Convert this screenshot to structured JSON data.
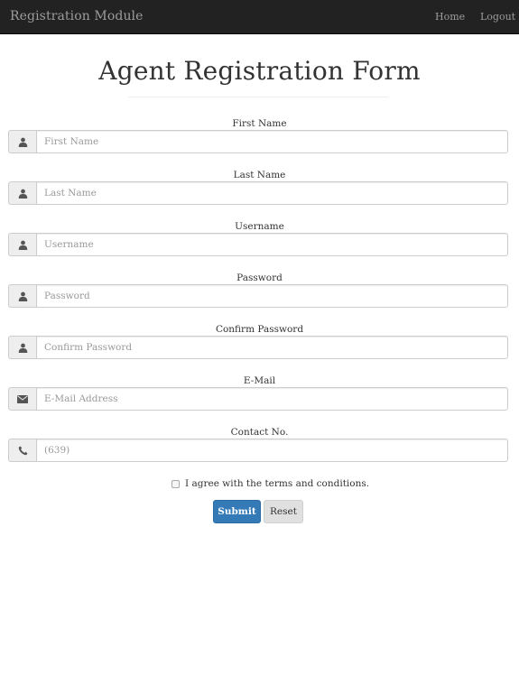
{
  "navbar": {
    "brand": "Registration Module",
    "links": [
      {
        "label": "Home"
      },
      {
        "label": "Logout"
      }
    ]
  },
  "page": {
    "title": "Agent Registration Form"
  },
  "form": {
    "fields": [
      {
        "label": "First Name",
        "placeholder": "First Name",
        "value": "",
        "icon": "user-icon"
      },
      {
        "label": "Last Name",
        "placeholder": "Last Name",
        "value": "",
        "icon": "user-icon"
      },
      {
        "label": "Username",
        "placeholder": "Username",
        "value": "",
        "icon": "user-icon"
      },
      {
        "label": "Password",
        "placeholder": "Password",
        "value": "",
        "icon": "user-icon"
      },
      {
        "label": "Confirm Password",
        "placeholder": "Confirm Password",
        "value": "",
        "icon": "user-icon"
      },
      {
        "label": "E-Mail",
        "placeholder": "E-Mail Address",
        "value": "",
        "icon": "envelope-icon"
      },
      {
        "label": "Contact No.",
        "placeholder": "(639)",
        "value": "",
        "icon": "phone-icon"
      }
    ],
    "terms_label": "I agree with the terms and conditions.",
    "terms_checked": false,
    "submit_label": "Submit",
    "reset_label": "Reset"
  },
  "colors": {
    "navbar_bg": "#222222",
    "navbar_text": "#9d9d9d",
    "primary": "#337ab7",
    "addon_bg": "#eeeeee"
  }
}
